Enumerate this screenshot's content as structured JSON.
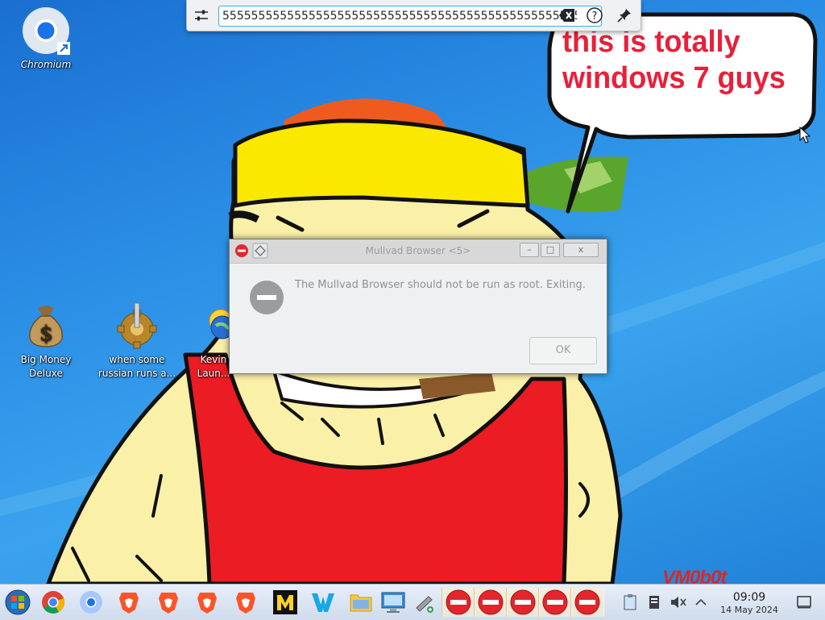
{
  "desktop": {
    "icons": [
      {
        "label": "Chromium"
      },
      {
        "label": "Big Money Deluxe"
      },
      {
        "label": "when some russian runs a..."
      },
      {
        "label": "Kevin Laun..."
      }
    ],
    "bubble_text": "this is totally windows 7 guys",
    "watermark": "VM0b0t"
  },
  "search": {
    "value": "5555555555555555555555555555555555555555555555555555555"
  },
  "dialog": {
    "title": "Mullvad Browser <5>",
    "message": "The Mullvad Browser should not be run as root.  Exiting.",
    "ok_label": "OK",
    "min_glyph": "–",
    "max_glyph": "□",
    "close_glyph": "x"
  },
  "taskbar": {
    "pinned": [
      "start-orb-icon",
      "chrome-icon",
      "chromium-icon",
      "brave-icon",
      "brave-icon",
      "brave-icon",
      "brave-icon",
      "mullvad-m-icon",
      "waterfox-w-icon",
      "file-manager-icon",
      "system-settings-icon",
      "tools-icon"
    ],
    "tasks": [
      "stop-icon",
      "stop-icon",
      "stop-icon",
      "stop-icon",
      "stop-icon"
    ],
    "tray_time": "09:09",
    "tray_date": "14 May 2024"
  },
  "colors": {
    "bubble_text": "#e8203a",
    "stop_red": "#e3262b"
  }
}
